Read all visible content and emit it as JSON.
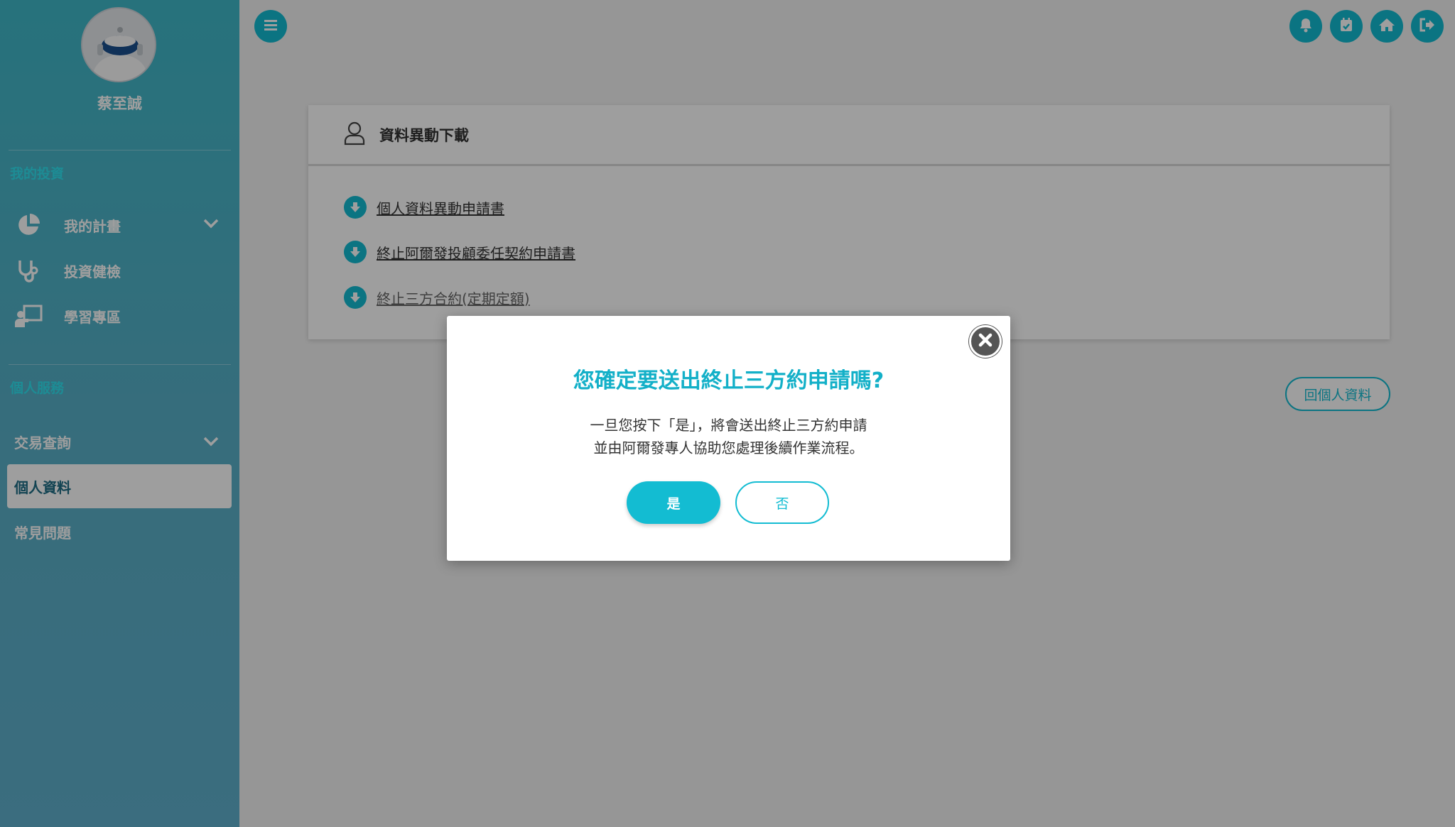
{
  "colors": {
    "accent": "#13bcd2",
    "sidebar": "#3fb8c9",
    "modal_title": "#13b0c8",
    "overlay": "rgba(0,0,0,0.38)"
  },
  "user": {
    "name": "蔡至誠"
  },
  "sidebar": {
    "section_investment": "我的投資",
    "items_investment": [
      {
        "label": "我的計畫",
        "icon": "pie-chart-icon",
        "has_dropdown": true
      },
      {
        "label": "投資健檢",
        "icon": "stethoscope-icon"
      },
      {
        "label": "學習專區",
        "icon": "teacher-board-icon"
      }
    ],
    "section_service": "個人服務",
    "items_service": [
      {
        "label": "交易查詢",
        "has_dropdown": true
      },
      {
        "label": "個人資料",
        "active": true
      },
      {
        "label": "常見問題"
      }
    ]
  },
  "topbar": {
    "icons": [
      "menu-icon",
      "bell-icon",
      "calendar-check-icon",
      "home-icon",
      "logout-icon"
    ]
  },
  "card": {
    "title": "資料異動下載",
    "links": [
      "個人資料異動申請書",
      "終止阿爾發投顧委任契約申請書",
      "終止三方合約(定期定額)"
    ]
  },
  "back_button": "回個人資料",
  "modal": {
    "title": "您確定要送出終止三方約申請嗎?",
    "body_line1": "一旦您按下「是」，將會送出終止三方約申請",
    "body_line2": "並由阿爾發專人協助您處理後續作業流程。",
    "yes_label": "是",
    "no_label": "否"
  }
}
